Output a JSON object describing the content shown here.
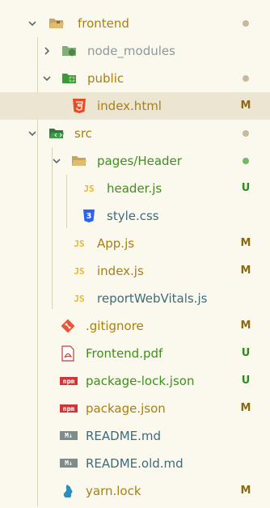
{
  "colors": {
    "background": "#fbf8ee",
    "selected_background": "#ece5d2",
    "text_default": "#3f6b78",
    "text_modified": "#a87f12",
    "text_untracked": "#3f8f1f",
    "text_muted": "#8a9a9c",
    "status_M": "#8a6a12",
    "status_U": "#2f8a1e",
    "dot_default": "#c6b99c",
    "dot_green": "#78b46a"
  },
  "tree": {
    "items": [
      {
        "label": "frontend",
        "chevron": "open",
        "icon": "folder-open-icon",
        "status_kind": "dot"
      },
      {
        "label": "node_modules",
        "chevron": "closed",
        "icon": "node-folder-icon"
      },
      {
        "label": "public",
        "chevron": "open",
        "icon": "public-folder-icon",
        "status_kind": "dot"
      },
      {
        "label": "index.html",
        "icon": "html-file-icon",
        "status": "M",
        "selected": true
      },
      {
        "label": "src",
        "chevron": "open",
        "icon": "src-folder-icon",
        "status_kind": "dot"
      },
      {
        "label": "pages/Header",
        "chevron": "open",
        "icon": "folder-open-icon",
        "status_kind": "dot-green"
      },
      {
        "label": "header.js",
        "icon": "js-file-icon",
        "icon_text": "JS",
        "status": "U"
      },
      {
        "label": "style.css",
        "icon": "css-file-icon",
        "icon_text": "3"
      },
      {
        "label": "App.js",
        "icon": "js-file-icon",
        "icon_text": "JS",
        "status": "M"
      },
      {
        "label": "index.js",
        "icon": "js-file-icon",
        "icon_text": "JS",
        "status": "M"
      },
      {
        "label": "reportWebVitals.js",
        "icon": "js-file-icon",
        "icon_text": "JS"
      },
      {
        "label": ".gitignore",
        "icon": "git-icon",
        "status": "M"
      },
      {
        "label": "Frontend.pdf",
        "icon": "pdf-file-icon",
        "status": "U"
      },
      {
        "label": "package-lock.json",
        "icon": "npm-icon",
        "icon_text": "npm",
        "status": "U"
      },
      {
        "label": "package.json",
        "icon": "npm-icon",
        "icon_text": "npm",
        "status": "M"
      },
      {
        "label": "README.md",
        "icon": "markdown-icon",
        "icon_text": "M↓"
      },
      {
        "label": "README.old.md",
        "icon": "markdown-icon",
        "icon_text": "M↓"
      },
      {
        "label": "yarn.lock",
        "icon": "yarn-icon",
        "status": "M"
      }
    ]
  }
}
